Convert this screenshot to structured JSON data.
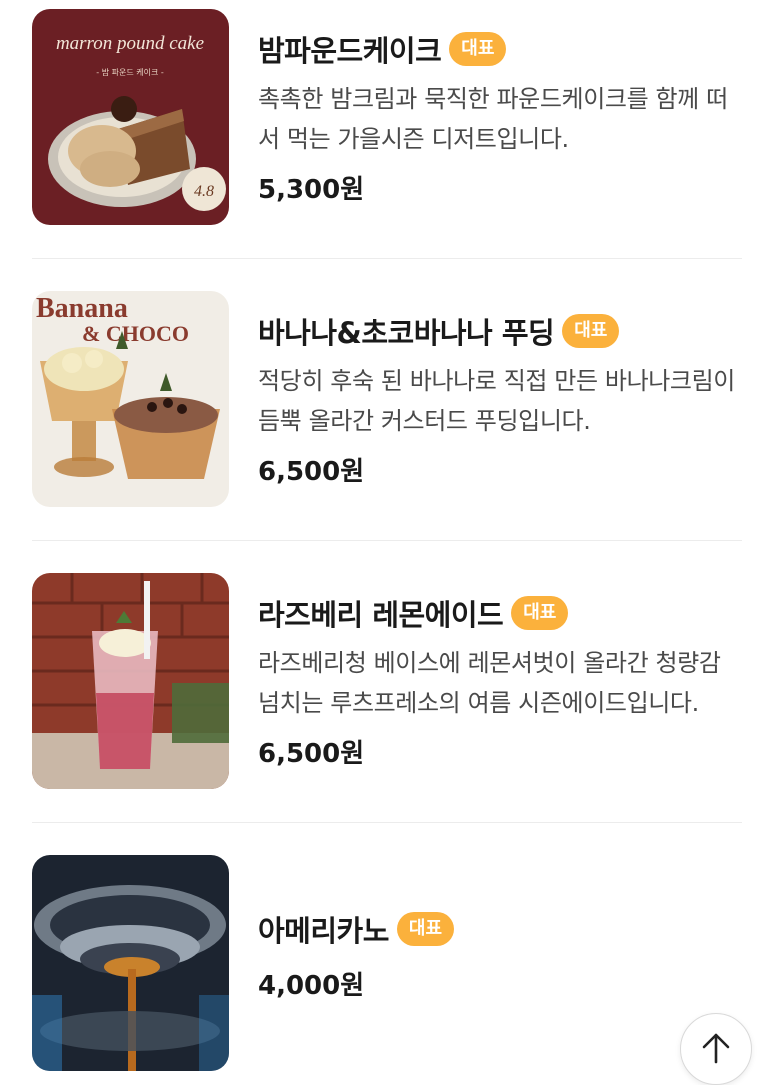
{
  "menu": {
    "badge_label": "대표",
    "items": [
      {
        "name": "밤파운드케이크",
        "description": "촉촉한 밤크림과 묵직한 파운드케이크를 함께 떠서 먹는 가을시즌 디저트입니다.",
        "price": "5,300원",
        "image": {
          "title": "marron pound cake",
          "subtitle": "- 밤 파운드 케이크 -",
          "tag": "4.8"
        }
      },
      {
        "name": "바나나&초코바나나 푸딩",
        "description": "적당히 후숙 된 바나나로 직접 만든 바나나크림이 듬뿍 올라간 커스터드 푸딩입니다.",
        "price": "6,500원",
        "image": {
          "title_line1": "Banana",
          "title_line2": "& CHOCO"
        }
      },
      {
        "name": "라즈베리 레몬에이드",
        "description": "라즈베리청 베이스에 레몬셔벗이 올라간 청량감 넘치는 루츠프레소의 여름 시즌에이드입니다.",
        "price": "6,500원"
      },
      {
        "name": "아메리카노",
        "description": "",
        "price": "4,000원"
      }
    ]
  },
  "scroll_top": {
    "icon": "arrow-up-icon"
  },
  "colors": {
    "badge": "#fbb13c",
    "text": "#1a1a1a",
    "description": "#4a4a4a",
    "divider": "#ececec"
  }
}
